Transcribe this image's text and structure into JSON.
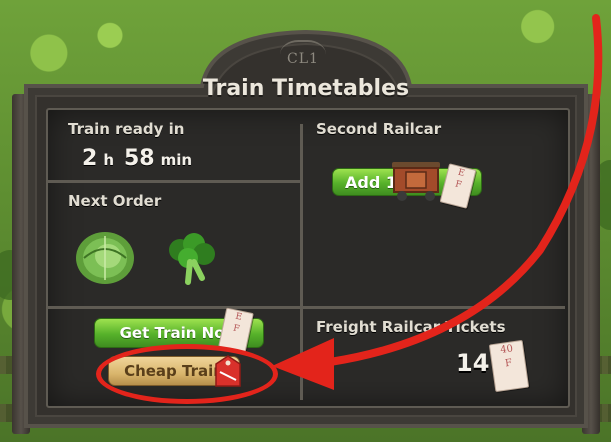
{
  "board": {
    "crest": "CL1",
    "title": "Train Timetables"
  },
  "train_ready": {
    "label": "Train ready in",
    "hours": "2",
    "hours_unit": "h",
    "minutes": "58",
    "minutes_unit": "min"
  },
  "next_order": {
    "label": "Next Order",
    "items": [
      {
        "icon": "cabbage-icon"
      },
      {
        "icon": "broccoli-icon"
      }
    ]
  },
  "second_railcar": {
    "label": "Second Railcar",
    "button_label": "Add 1",
    "icon": "railcar-icon"
  },
  "actions": {
    "get_train_now_label": "Get Train Now",
    "cheap_train_label": "Cheap Train",
    "sale_tag_icon": "sale-tag-icon"
  },
  "freight_tickets": {
    "label": "Freight Railcar Tickets",
    "count": "14",
    "icon": "ticket-icon"
  },
  "colors": {
    "highlight": "#e3241b",
    "green_button": "#56b12a",
    "tan_button": "#d9b56c",
    "chalkboard": "#2b2a28"
  }
}
